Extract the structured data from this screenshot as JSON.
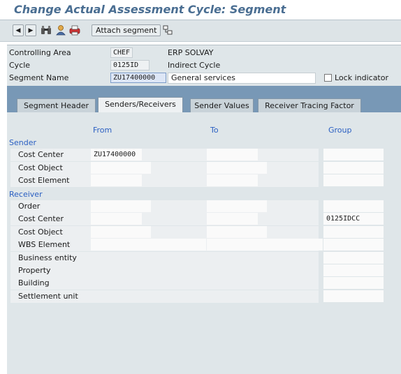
{
  "title": "Change Actual Assessment Cycle: Segment",
  "toolbar": {
    "attach_label": "Attach segment",
    "icons": [
      "previous-icon",
      "next-icon",
      "binoculars-icon",
      "person-icon",
      "print-icon",
      "hierarchy-icon"
    ]
  },
  "header": {
    "controlling_area": {
      "label": "Controlling Area",
      "value": "CHEF",
      "desc": "ERP SOLVAY"
    },
    "cycle": {
      "label": "Cycle",
      "value": "0125ID",
      "desc": "Indirect Cycle"
    },
    "segment": {
      "label": "Segment Name",
      "value": "ZU17400000",
      "desc": "General services"
    },
    "lock": {
      "label": "Lock indicator",
      "checked": false
    }
  },
  "tabs": [
    {
      "label": "Segment Header",
      "active": false
    },
    {
      "label": "Senders/Receivers",
      "active": true
    },
    {
      "label": "Sender Values",
      "active": false
    },
    {
      "label": "Receiver Tracing Factor",
      "active": false
    }
  ],
  "columns": {
    "from": "From",
    "to": "To",
    "group": "Group"
  },
  "sender": {
    "heading": "Sender",
    "rows": [
      {
        "label": "Cost Center",
        "from": "ZU17400000",
        "to": "",
        "group": ""
      },
      {
        "label": "Cost Object",
        "from": "",
        "to": "",
        "group": ""
      },
      {
        "label": "Cost Element",
        "from": "",
        "to": "",
        "group": ""
      }
    ]
  },
  "receiver": {
    "heading": "Receiver",
    "rows": [
      {
        "label": "Order",
        "from": "",
        "to": "",
        "group": ""
      },
      {
        "label": "Cost Center",
        "from": "",
        "to": "",
        "group": "0125IDCC"
      },
      {
        "label": "Cost Object",
        "from": "",
        "to": "",
        "group": ""
      },
      {
        "label": "WBS Element",
        "from": "",
        "to": "",
        "group": ""
      },
      {
        "label": "Business entity",
        "from": "",
        "to": "",
        "group": ""
      },
      {
        "label": "Property",
        "from": "",
        "to": "",
        "group": ""
      },
      {
        "label": "Building",
        "from": "",
        "to": "",
        "group": ""
      },
      {
        "label": "Settlement unit",
        "from": "",
        "to": "",
        "group": ""
      }
    ]
  }
}
